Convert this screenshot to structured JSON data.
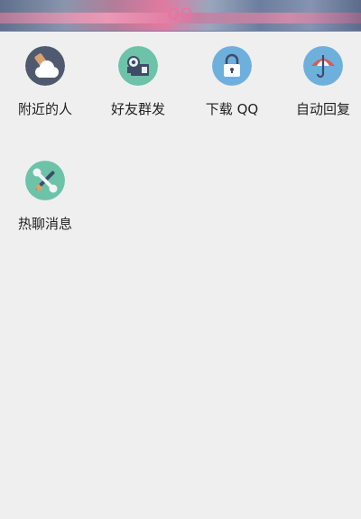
{
  "header": {
    "title": "QQ"
  },
  "menu": {
    "items": [
      {
        "label": "附近的人",
        "icon": "cloud-weather-icon",
        "color": "#4f5a70"
      },
      {
        "label": "好友群发",
        "icon": "video-camera-icon",
        "color": "#6cc3a8"
      },
      {
        "label": "下载 QQ",
        "icon": "lock-icon",
        "color": "#6eb0dc"
      },
      {
        "label": "自动回复",
        "icon": "umbrella-icon",
        "color": "#6eb0dc"
      },
      {
        "label": "热聊消息",
        "icon": "tools-icon",
        "color": "#6cc3a8"
      }
    ]
  }
}
